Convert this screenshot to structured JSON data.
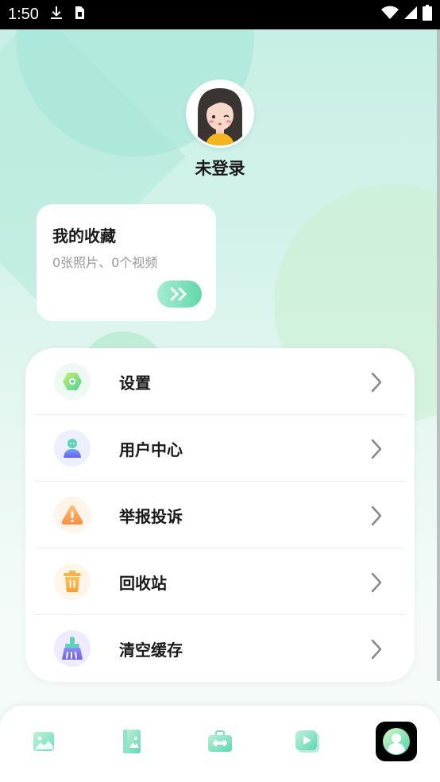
{
  "status_bar": {
    "time": "1:50"
  },
  "profile": {
    "username": "未登录"
  },
  "favorites": {
    "title": "我的收藏",
    "subtitle": "0张照片、0个视频",
    "open_icon": "double-chevron-right-icon"
  },
  "menu": {
    "items": [
      {
        "label": "设置",
        "icon": "settings-hexagon-icon",
        "icon_bg": "#eef9f4"
      },
      {
        "label": "用户中心",
        "icon": "user-icon",
        "icon_bg": "#eceffc"
      },
      {
        "label": "举报投诉",
        "icon": "warning-icon",
        "icon_bg": "#fff4ea"
      },
      {
        "label": "回收站",
        "icon": "trash-icon",
        "icon_bg": "#fff6ea"
      },
      {
        "label": "清空缓存",
        "icon": "broom-icon",
        "icon_bg": "#efeafc"
      }
    ]
  },
  "tabs": [
    {
      "name": "photos",
      "icon": "image-icon"
    },
    {
      "name": "album",
      "icon": "photo-book-icon"
    },
    {
      "name": "tools",
      "icon": "toolbox-icon"
    },
    {
      "name": "videos",
      "icon": "play-icon"
    },
    {
      "name": "profile",
      "icon": "profile-icon",
      "active": true
    }
  ],
  "colors": {
    "accent": "#62d8a8",
    "text": "#1a1a1a",
    "muted": "#999999"
  }
}
